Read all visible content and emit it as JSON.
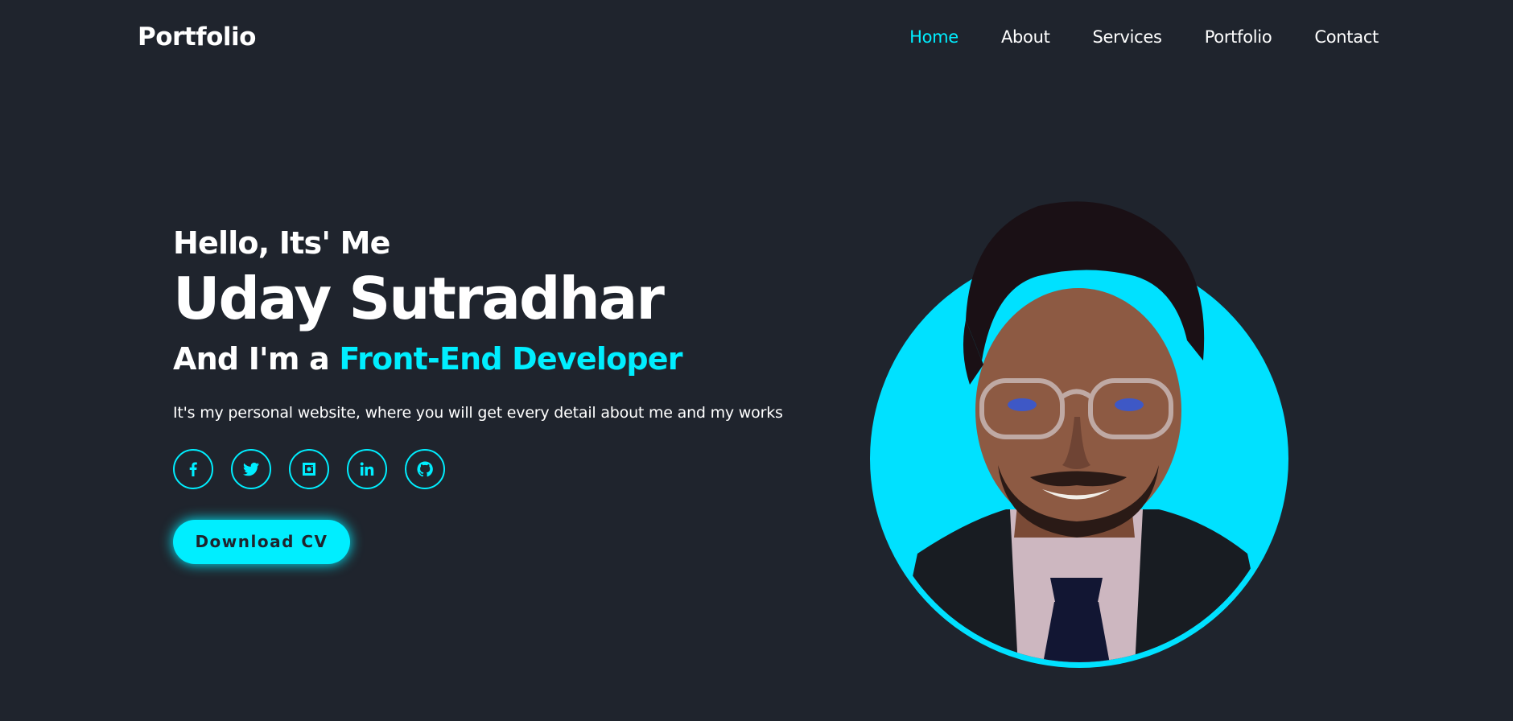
{
  "header": {
    "logo": "Portfolio",
    "nav": [
      "Home",
      "About",
      "Services",
      "Portfolio",
      "Contact"
    ],
    "active_nav": "Home"
  },
  "hero": {
    "greeting": "Hello, Its' Me",
    "name": "Uday Sutradhar",
    "role_prefix": "And I'm a ",
    "role_highlight": "Front-End Developer",
    "description": "It's my personal website, where you will get every detail about me and my works",
    "socials": [
      "facebook-icon",
      "twitter-icon",
      "instagram-icon",
      "linkedin-icon",
      "github-icon"
    ],
    "cta": "Download CV"
  },
  "colors": {
    "background": "#1f242d",
    "accent": "#00eeff",
    "text": "#ffffff"
  }
}
